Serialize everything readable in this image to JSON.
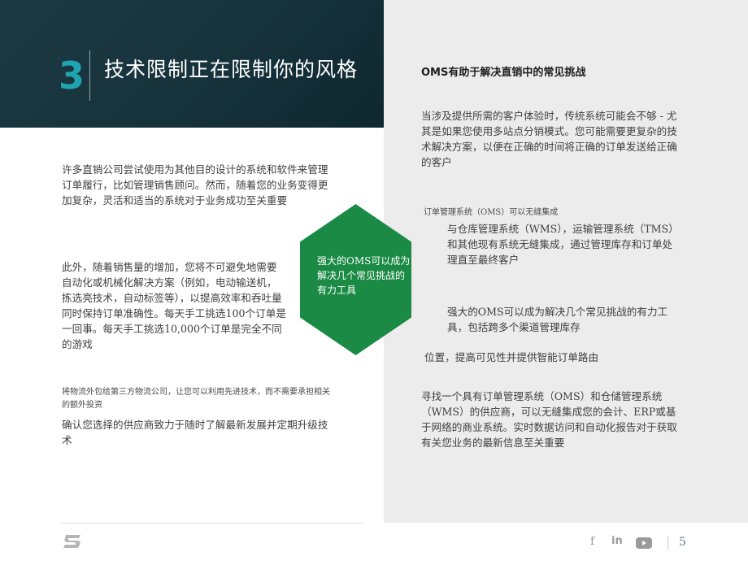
{
  "header": {
    "chapter_number": "3",
    "chapter_title": "技术限制正在限制你的风格"
  },
  "left": {
    "p1": "许多直销公司尝试使用为其他目的设计的系统和软件来管理订单履行，比如管理销售顾问。然而，随着您的业务变得更加复杂，灵活和适当的系统对于业务成功至关重要",
    "p2": "此外，随着销售量的增加，您将不可避免地需要自动化或机械化解决方案（例如，电动输送机，拣选亮技术，自动标签等），以提高效率和吞吐量同时保持订单准确性。每天手工挑选100个订单是一回事。每天手工挑选10,000个订单是完全不同的游戏",
    "p3_small": "将物流外包给第三方物流公司，让您可以利用先进技术，而不需要承担相关的额外投资",
    "p4": "确认您选择的供应商致力于随时了解最新发展并定期升级技术"
  },
  "hexagon": {
    "text": "强大的OMS可以成为解决几个常见挑战的有力工具"
  },
  "right": {
    "heading": "OMS有助于解决直销中的常见挑战",
    "p1": "当涉及提供所需的客户体验时，传统系统可能会不够 - 尤其是如果您使用多站点分销模式。您可能需要更复杂的技术解决方案，以便在正确的时间将正确的订单发送给正确的客户",
    "small1": "订单管理系统（OMS）可以无缝集成",
    "p2": "与仓库管理系统（WMS），运输管理系统（TMS）和其他现有系统无缝集成，通过管理库存和订单处理直至最终客户",
    "p3": "强大的OMS可以成为解决几个常见挑战的有力工具，包括跨多个渠道管理库存",
    "p4": "位置，提高可见性并提供智能订单路由",
    "p5": "寻找一个具有订单管理系统（OMS）和仓储管理系统（WMS）的供应商，可以无缝集成您的会计、ERP或基于网络的商业系统。实时数据访问和自动化报告对于获取有关您业务的最新信息至关重要"
  },
  "footer": {
    "page_number": "5",
    "social": [
      "facebook-icon",
      "linkedin-icon",
      "youtube-icon"
    ],
    "facebook_glyph": "f",
    "linkedin_glyph": "in"
  },
  "colors": {
    "header_band": "#16323b",
    "accent_teal": "#1fa5b0",
    "hexagon_green": "#1a8a45",
    "right_panel": "#ececec"
  }
}
